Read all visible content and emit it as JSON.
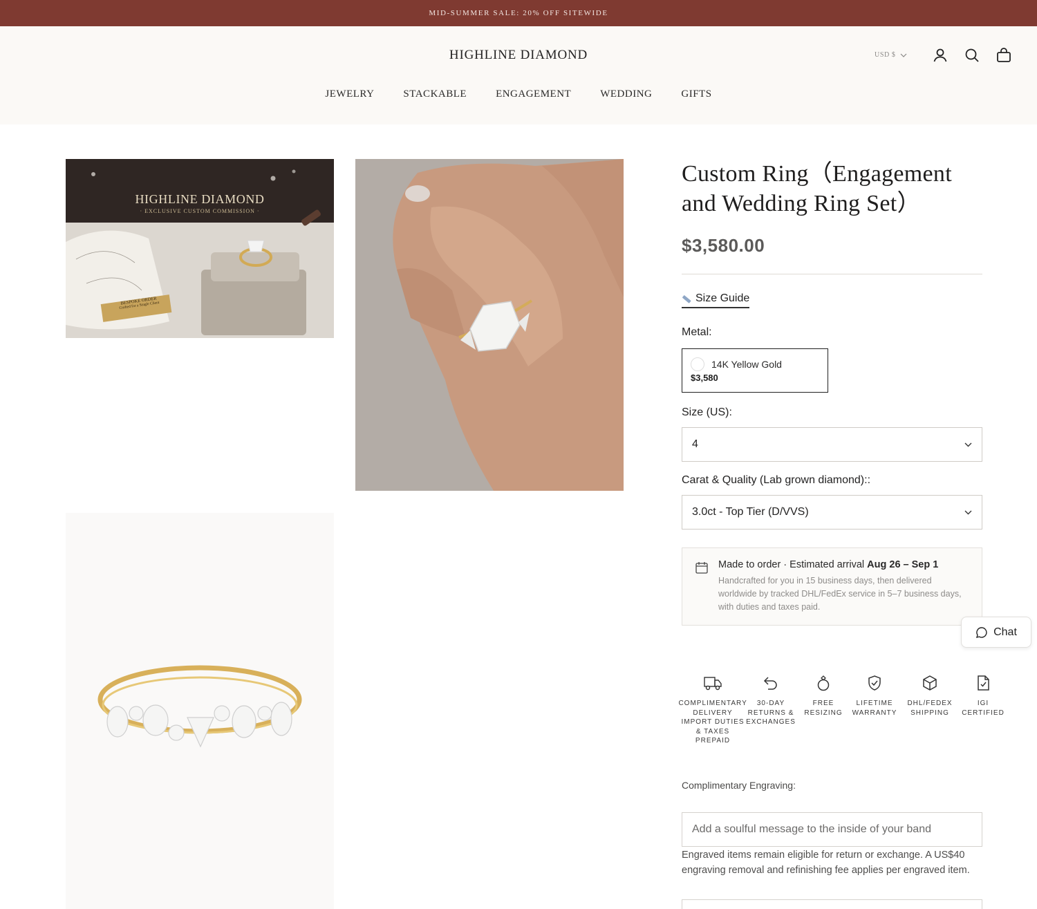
{
  "announcement": "MID-SUMMER SALE: 20% OFF SITEWIDE",
  "header": {
    "logo": "HIGHLINE DIAMOND",
    "currency": "USD $",
    "nav": [
      "JEWELRY",
      "STACKABLE",
      "ENGAGEMENT",
      "WEDDING",
      "GIFTS"
    ]
  },
  "gallery": {
    "image1": {
      "brand": "HIGHLINE DIAMOND",
      "tagline": "· EXCLUSIVE CUSTOM COMMISSION ·",
      "plaque_title": "BESPOKE ORDER",
      "plaque_sub": "Crafted for a Single Client"
    }
  },
  "product": {
    "title": "Custom Ring（Engagement and Wedding Ring Set）",
    "price": "$3,580.00",
    "size_guide": "Size Guide",
    "metal_label": "Metal:",
    "metal_option": {
      "name": "14K Yellow Gold",
      "price": "$3,580"
    },
    "size_label": "Size (US):",
    "size_value": "4",
    "carat_label": "Carat & Quality (Lab grown diamond)::",
    "carat_value": "3.0ct - Top Tier (D/VVS)",
    "shipping": {
      "title_prefix": "Made to order · Estimated arrival ",
      "title_dates": "Aug 26 – Sep 1",
      "description": "Handcrafted for you in 15 business days, then delivered worldwide by tracked DHL/FedEx service in 5–7 business days, with duties and taxes paid."
    }
  },
  "features": [
    {
      "icon": "truck-icon",
      "label": "COMPLIMENTARY DELIVERY IMPORT DUTIES & TAXES PREPAID"
    },
    {
      "icon": "return-arrow-icon",
      "label": "30-DAY RETURNS & EXCHANGES"
    },
    {
      "icon": "ring-icon",
      "label": "FREE RESIZING"
    },
    {
      "icon": "shield-check-icon",
      "label": "LIFETIME WARRANTY"
    },
    {
      "icon": "box-icon",
      "label": "DHL/FEDEX SHIPPING"
    },
    {
      "icon": "certificate-icon",
      "label": "IGI CERTIFIED"
    }
  ],
  "engraving": {
    "label": "Complimentary Engraving:",
    "placeholder": "Add a soulful message to the inside of your band",
    "note": "Engraved items remain eligible for return or exchange. A US$40 engraving removal and refinishing fee applies per engraved item."
  },
  "chat": {
    "label": "Chat"
  }
}
